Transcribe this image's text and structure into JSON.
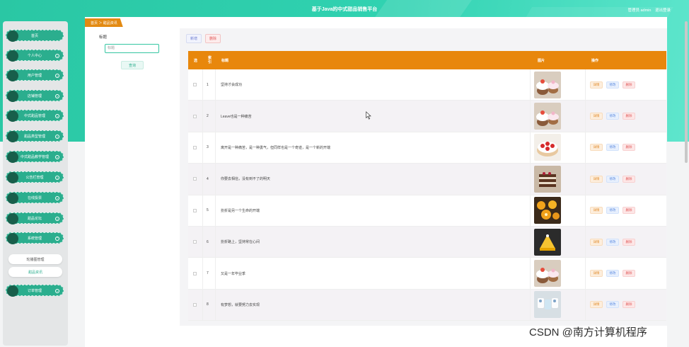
{
  "header": {
    "site_title": "基于Java的中式甜品销售平台",
    "user_label": "管理员 admin",
    "logout_label": "退出登录"
  },
  "sidebar": {
    "items": [
      {
        "label": "首页",
        "has_chevron": false
      },
      {
        "label": "个人中心",
        "has_chevron": true
      },
      {
        "label": "用户管理",
        "has_chevron": true
      },
      {
        "label": "店铺管理",
        "has_chevron": true
      },
      {
        "label": "中式甜品管理",
        "has_chevron": true
      },
      {
        "label": "甜品类型管理",
        "has_chevron": true
      },
      {
        "label": "中式甜品教学管理",
        "has_chevron": true
      },
      {
        "label": "公告栏管理",
        "has_chevron": true
      },
      {
        "label": "在线投票",
        "has_chevron": true
      },
      {
        "label": "甜品论坛",
        "has_chevron": true
      },
      {
        "label": "系统管理",
        "has_chevron": true,
        "expanded": true
      }
    ],
    "sub_items": [
      {
        "label": "轮播图管理",
        "active": false
      },
      {
        "label": "甜品资讯",
        "active": true
      }
    ],
    "last_item": {
      "label": "订单管理",
      "has_chevron": true
    }
  },
  "breadcrumb": {
    "text": "首页 ＞ 甜品资讯"
  },
  "search": {
    "label": "标题",
    "placeholder": "标题",
    "button_label": "查询"
  },
  "toolbar": {
    "add_label": "新增",
    "delete_label": "删除"
  },
  "table": {
    "headers": {
      "select": "选",
      "index": "索引",
      "title": "标题",
      "image": "图片",
      "action": "操作"
    },
    "rows": [
      {
        "index": "1",
        "title": "坚持才会成功",
        "image": "cupcake"
      },
      {
        "index": "2",
        "title": "Leave也是一种痛苦",
        "image": "cupcake"
      },
      {
        "index": "3",
        "title": "离开是一种痛苦，是一种勇气，但同样也是一个奇迹，是一个新的开端",
        "image": "strawberry-cake"
      },
      {
        "index": "4",
        "title": "你要去相信，没有到不了的明天",
        "image": "layer-cake"
      },
      {
        "index": "5",
        "title": "扮折是另一个生命的开端",
        "image": "tarts"
      },
      {
        "index": "6",
        "title": "扮折路上，坚持常在心间",
        "image": "yellow-cake"
      },
      {
        "index": "7",
        "title": "又是一年毕业季",
        "image": "cupcake"
      },
      {
        "index": "8",
        "title": "有梦想，就要努力去实现",
        "image": "dessert-cups"
      }
    ],
    "actions": {
      "detail": "详情",
      "edit": "修改",
      "delete": "删除"
    }
  },
  "watermark": "CSDN @南方计算机程序",
  "colors": {
    "accent": "#2bae8e",
    "header_orange": "#e8870c",
    "sidebar_bg": "#e4e6e7"
  }
}
